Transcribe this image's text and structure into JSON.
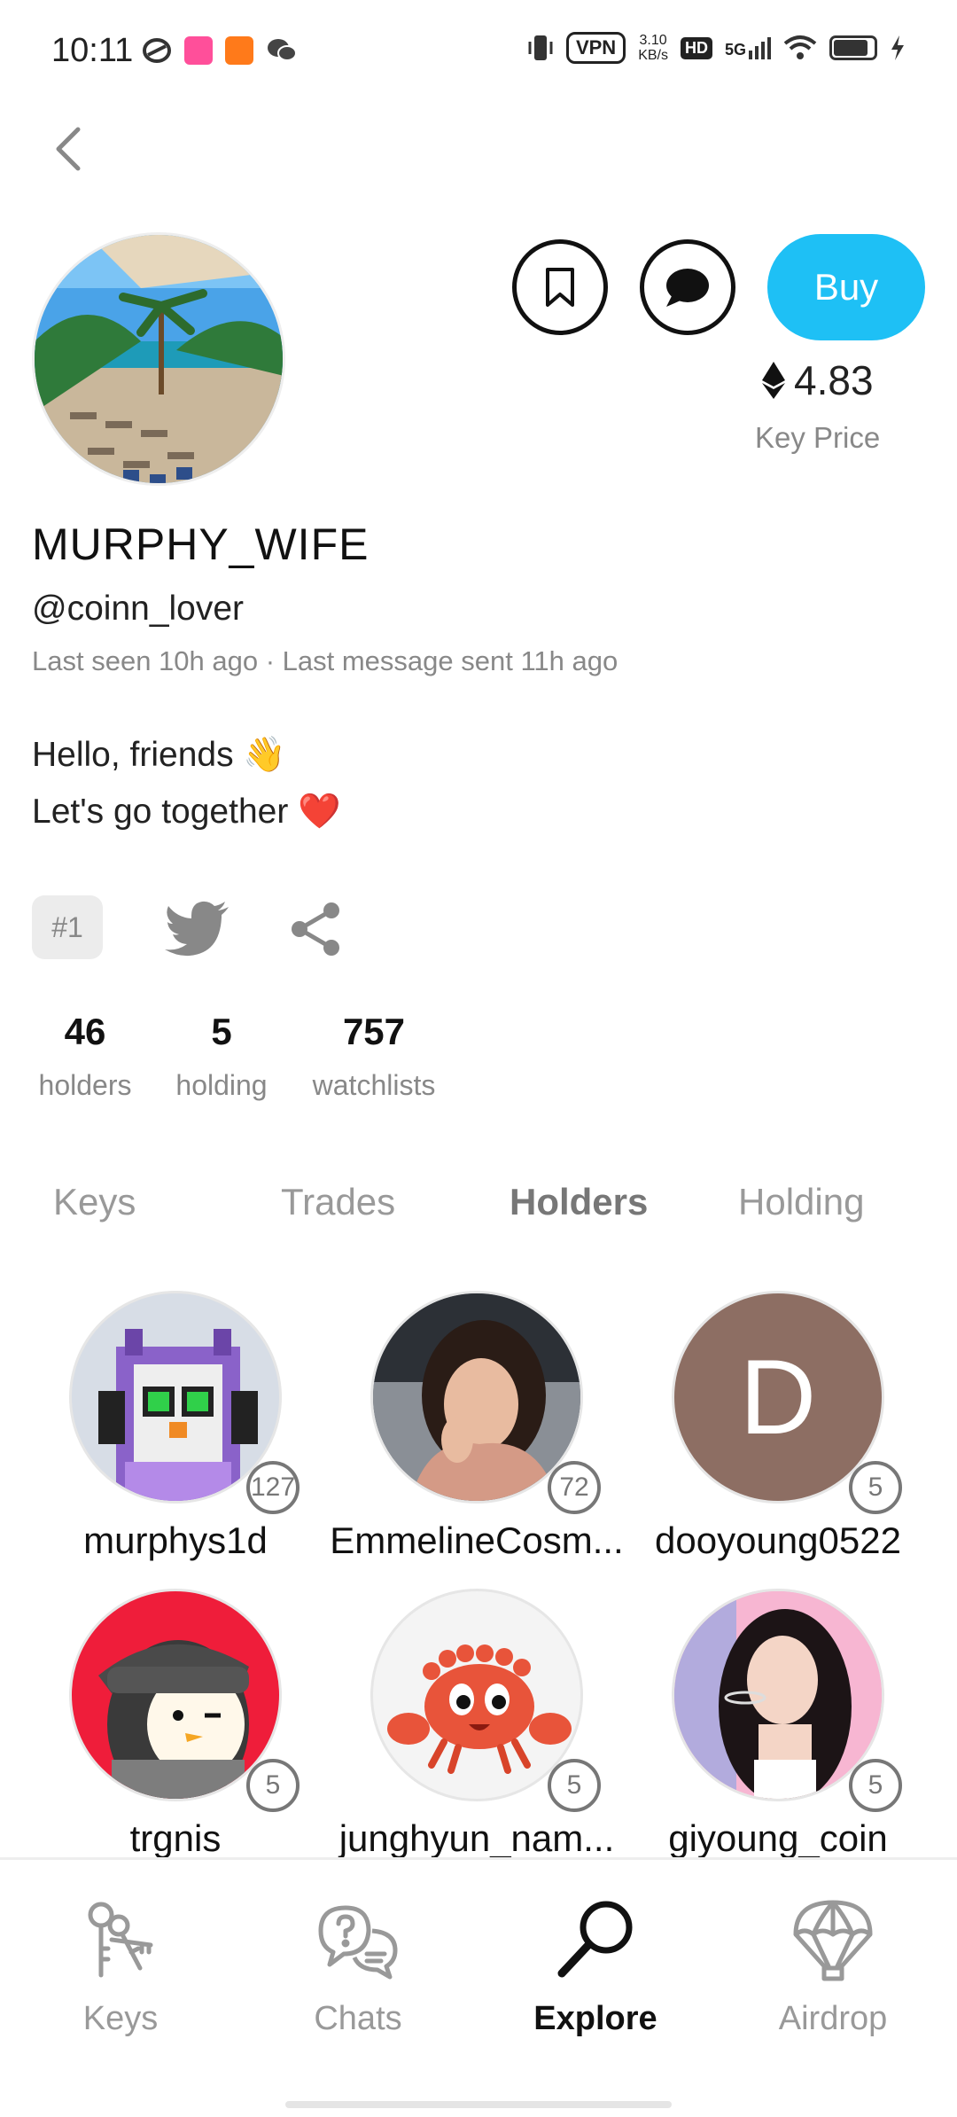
{
  "status": {
    "time": "10:11",
    "vpn": "VPN",
    "speed_value": "3.10",
    "speed_unit": "KB/s",
    "hd": "HD",
    "network": "5G"
  },
  "profile": {
    "display_name": "MURPHY_WIFE",
    "handle": "@coinn_lover",
    "last_seen": "Last seen 10h ago · Last message sent 11h ago",
    "bio_line1": "Hello, friends 👋",
    "bio_line2": "Let's go together ❤️",
    "rank": "#1"
  },
  "actions": {
    "buy_label": "Buy",
    "key_price": "4.83",
    "key_price_label": "Key Price"
  },
  "stats": [
    {
      "value": "46",
      "label": "holders"
    },
    {
      "value": "5",
      "label": "holding"
    },
    {
      "value": "757",
      "label": "watchlists"
    }
  ],
  "tabs": [
    {
      "label": "Keys",
      "active": false
    },
    {
      "label": "Trades",
      "active": false
    },
    {
      "label": "Holders",
      "active": true
    },
    {
      "label": "Holding",
      "active": false
    }
  ],
  "holders": [
    {
      "name": "murphys1d",
      "count": "127",
      "avatar": "pixel-owl-headphones"
    },
    {
      "name": "EmmelineCosm...",
      "count": "72",
      "avatar": "photo-woman"
    },
    {
      "name": "dooyoung0522",
      "count": "5",
      "avatar": "letter",
      "letter": "D",
      "color": "#8d6e63"
    },
    {
      "name": "trgnis",
      "count": "5",
      "avatar": "penguin-cap"
    },
    {
      "name": "junghyun_nam...",
      "count": "5",
      "avatar": "crab"
    },
    {
      "name": "giyoung_coin",
      "count": "5",
      "avatar": "photo-girl-pink"
    }
  ],
  "nav": [
    {
      "label": "Keys",
      "icon": "keys-icon",
      "active": false
    },
    {
      "label": "Chats",
      "icon": "chats-icon",
      "active": false
    },
    {
      "label": "Explore",
      "icon": "explore-icon",
      "active": true
    },
    {
      "label": "Airdrop",
      "icon": "airdrop-icon",
      "active": false
    }
  ],
  "colors": {
    "accent": "#1ec0f5",
    "muted_text": "#888888"
  }
}
